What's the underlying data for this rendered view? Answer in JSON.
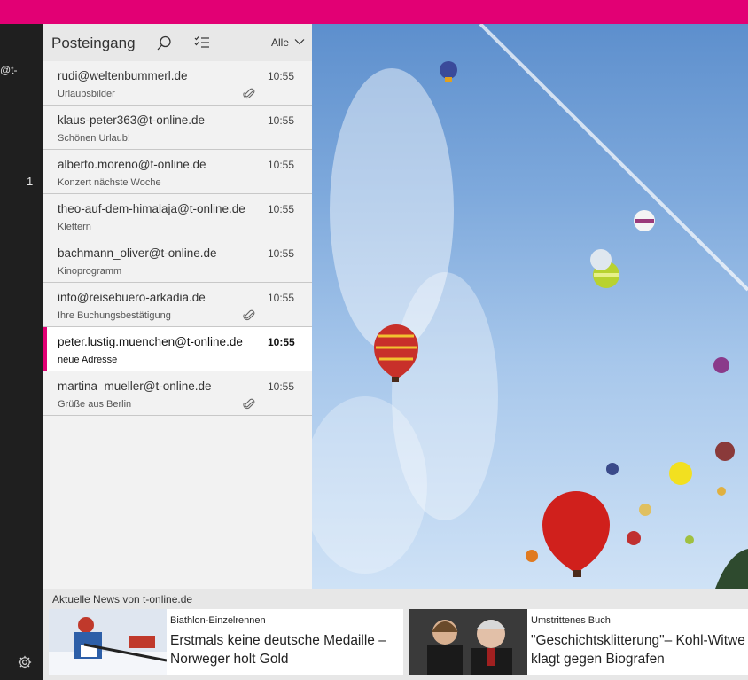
{
  "colors": {
    "accent": "#e20074",
    "rail": "#1f1f1f",
    "pane": "#f2f2f2"
  },
  "left_rail": {
    "account_fragment": "@t-",
    "unread_count": "1"
  },
  "mail": {
    "title": "Posteingang",
    "filter": "Alle",
    "items": [
      {
        "sender": "rudi@weltenbummerl.de",
        "subject": "Urlaubsbilder",
        "time": "10:55",
        "attachment": true
      },
      {
        "sender": "klaus-peter363@t-online.de",
        "subject": "Schönen Urlaub!",
        "time": "10:55",
        "attachment": false
      },
      {
        "sender": "alberto.moreno@t-online.de",
        "subject": "Konzert nächste Woche",
        "time": "10:55",
        "attachment": false
      },
      {
        "sender": "theo-auf-dem-himalaja@t-online.de",
        "subject": "Klettern",
        "time": "10:55",
        "attachment": false
      },
      {
        "sender": "bachmann_oliver@t-online.de",
        "subject": "Kinoprogramm",
        "time": "10:55",
        "attachment": false
      },
      {
        "sender": "info@reisebuero-arkadia.de",
        "subject": "Ihre Buchungsbestätigung",
        "time": "10:55",
        "attachment": true
      },
      {
        "sender": "peter.lustig.muenchen@t-online.de",
        "subject": "neue Adresse",
        "time": "10:55",
        "attachment": false,
        "selected": true
      },
      {
        "sender": "martina–mueller@t-online.de",
        "subject": "Grüße aus Berlin",
        "time": "10:55",
        "attachment": true
      }
    ]
  },
  "news": {
    "title": "Aktuelle News von t-online.de",
    "cards": [
      {
        "kicker": "Biathlon-Einzelrennen",
        "headline": "Erstmals keine deutsche Medaille – Norweger holt Gold"
      },
      {
        "kicker": "Umstrittenes Buch",
        "headline": "\"Geschichtsklitterung\"– Kohl-Witwe klagt gegen Biografen"
      }
    ]
  }
}
